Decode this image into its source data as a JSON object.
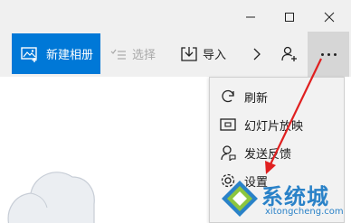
{
  "window_controls": {
    "minimize_icon": "minimize-icon",
    "maximize_icon": "maximize-icon",
    "close_icon": "close-icon"
  },
  "toolbar": {
    "new_album_label": "新建相册",
    "select_label": "选择",
    "import_label": "导入",
    "accent_color": "#0078d7"
  },
  "menu": {
    "items": [
      {
        "label": "刷新",
        "icon": "refresh-icon"
      },
      {
        "label": "幻灯片放映",
        "icon": "slideshow-icon"
      },
      {
        "label": "发送反馈",
        "icon": "feedback-icon"
      },
      {
        "label": "设置",
        "icon": "gear-icon"
      }
    ]
  },
  "watermark": {
    "name": "系统城",
    "url": "xitongcheng.com",
    "color": "#2a82c8"
  },
  "annotation": {
    "arrow_color": "#e02020"
  }
}
